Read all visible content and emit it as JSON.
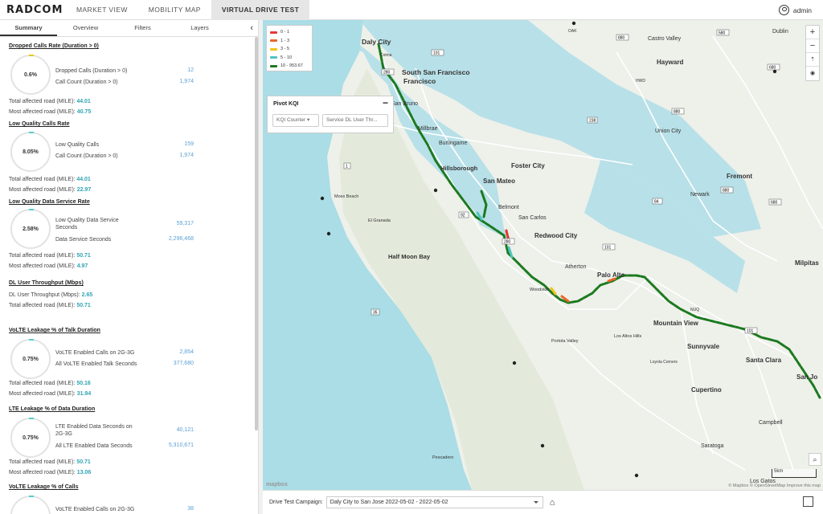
{
  "app": {
    "logo": "RADCOM",
    "user": "admin"
  },
  "nav": [
    {
      "label": "MARKET VIEW"
    },
    {
      "label": "MOBILITY MAP"
    },
    {
      "label": "VIRTUAL DRIVE TEST"
    }
  ],
  "panel_tabs": [
    {
      "label": "Summary"
    },
    {
      "label": "Overview"
    },
    {
      "label": "Filters"
    },
    {
      "label": "Layers"
    }
  ],
  "panel_collapse_glyph": "‹",
  "sections": [
    {
      "title": "Dropped Calls Rate (Duration > 0)",
      "ring": "0.6%",
      "kpis": [
        {
          "label": "Dropped Calls (Duration > 0)",
          "value": "12"
        },
        {
          "label": "Call Count (Duration > 0)",
          "value": "1,974"
        }
      ],
      "miles": [
        {
          "label": "Total affected road (MILE):",
          "value": "44.01"
        },
        {
          "label": "Most affected road (MILE):",
          "value": "40.75"
        }
      ]
    },
    {
      "title": "Low Quality Calls Rate",
      "ring": "8.05%",
      "kpis": [
        {
          "label": "Low Quality Calls",
          "value": "159"
        },
        {
          "label": "Call Count (Duration > 0)",
          "value": "1,974"
        }
      ],
      "miles": [
        {
          "label": "Total affected road (MILE):",
          "value": "44.01"
        },
        {
          "label": "Most affected road (MILE):",
          "value": "22.97"
        }
      ]
    },
    {
      "title": "Low Quality Data Service Rate",
      "ring": "2.58%",
      "kpis": [
        {
          "label": "Low Quality Data Service Seconds",
          "value": "59,317"
        },
        {
          "label": "Data Service Seconds",
          "value": "2,296,468"
        }
      ],
      "miles": [
        {
          "label": "Total affected road (MILE):",
          "value": "50.71"
        },
        {
          "label": "Most affected road (MILE):",
          "value": "4.97"
        }
      ]
    },
    {
      "title": "DL User Throughput (Mbps)",
      "miles": [
        {
          "label": "DL User Throughput (Mbps):",
          "value": "2.65"
        },
        {
          "label": "Total affected road (MILE):",
          "value": "50.71"
        }
      ]
    },
    {
      "title": "VoLTE Leakage % of Talk Duration",
      "ring": "0.75%",
      "kpis": [
        {
          "label": "VoLTE Enabled Calls on 2G-3G",
          "value": "2,854"
        },
        {
          "label": "All VoLTE Enabled Talk Seconds",
          "value": "377,680"
        }
      ],
      "miles": [
        {
          "label": "Total affected road (MILE):",
          "value": "50.16"
        },
        {
          "label": "Most affected road (MILE):",
          "value": "31.94"
        }
      ]
    },
    {
      "title": "LTE Leakage % of Data Duration",
      "ring": "0.75%",
      "kpis": [
        {
          "label": "LTE Enabled Data Seconds on 2G-3G",
          "value": "40,121"
        },
        {
          "label": "All LTE Enabled Data Seconds",
          "value": "5,310,671"
        }
      ],
      "miles": [
        {
          "label": "Total affected road (MILE):",
          "value": "50.71"
        },
        {
          "label": "Most affected road (MILE):",
          "value": "13.06"
        }
      ]
    },
    {
      "title": "VoLTE Leakage % of Calls",
      "kpis": [
        {
          "label": "VoLTE Enabled Calls on 2G-3G",
          "value": "38"
        }
      ]
    }
  ],
  "legend": [
    {
      "label": "0 - 1",
      "color": "#e53935"
    },
    {
      "label": "1 - 3",
      "color": "#e8672a"
    },
    {
      "label": "3 - 5",
      "color": "#f0c419"
    },
    {
      "label": "5 - 10",
      "color": "#4dc3c3"
    },
    {
      "label": "10 - 953.67",
      "color": "#1b7a1f"
    }
  ],
  "pivot": {
    "title": "Pivot KQI",
    "collapse": "−",
    "select1": "KQI Counter",
    "select2": "Service DL User Thr..."
  },
  "map_controls": {
    "zoom_in": "+",
    "zoom_out": "−",
    "scale": "5km",
    "attribution": "© Mapbox © OpenStreetMap  Improve this map",
    "brand": "mapbox"
  },
  "bottom": {
    "campaign_label": "Drive Test Campaign:",
    "campaign_value": "Daly City to San Jose 2022-05-02 - 2022-05-02"
  },
  "map_labels": [
    {
      "t": "Daly City",
      "big": true
    },
    {
      "t": "South San Francisco",
      "big": true
    },
    {
      "t": "San Bruno",
      "big": false
    },
    {
      "t": "Millbrae",
      "big": false
    },
    {
      "t": "Burlingame",
      "big": false
    },
    {
      "t": "Hillsborough",
      "big": true
    },
    {
      "t": "Foster City",
      "big": true
    },
    {
      "t": "San Mateo",
      "big": true
    },
    {
      "t": "Belmont",
      "big": false
    },
    {
      "t": "San Carlos",
      "big": false
    },
    {
      "t": "Redwood City",
      "big": true
    },
    {
      "t": "Atherton",
      "big": false
    },
    {
      "t": "Palo Alto",
      "big": true
    },
    {
      "t": "Woodside",
      "big": false
    },
    {
      "t": "Mountain View",
      "big": true
    },
    {
      "t": "Sunnyvale",
      "big": true
    },
    {
      "t": "Santa Clara",
      "big": true
    },
    {
      "t": "San Jo",
      "big": true
    },
    {
      "t": "Cupertino",
      "big": true
    },
    {
      "t": "Campbell",
      "big": false
    },
    {
      "t": "Saratoga",
      "big": false
    },
    {
      "t": "Los Gatos",
      "big": false
    },
    {
      "t": "Castro Valley",
      "big": false
    },
    {
      "t": "Hayward",
      "big": true
    },
    {
      "t": "Union City",
      "big": false
    },
    {
      "t": "Fremont",
      "big": true
    },
    {
      "t": "Newark",
      "big": false
    },
    {
      "t": "Milpitas",
      "big": true
    },
    {
      "t": "Dublin",
      "big": false
    },
    {
      "t": "Half Moon Bay",
      "big": true
    },
    {
      "t": "Moss Beach",
      "big": false
    },
    {
      "t": "El Granada",
      "big": false
    },
    {
      "t": "Portola Valley",
      "big": false
    },
    {
      "t": "Los Altos Hills",
      "big": false
    },
    {
      "t": "Pescadero",
      "big": false
    },
    {
      "t": "Loyola Corners",
      "big": false
    },
    {
      "t": "Colma",
      "big": false
    },
    {
      "t": "HWD",
      "big": false
    },
    {
      "t": "NUQ",
      "big": false
    },
    {
      "t": "OAK",
      "big": false
    }
  ],
  "road_badges": [
    "580",
    "880",
    "238",
    "680",
    "101",
    "92",
    "84",
    "280",
    "1",
    "35",
    "101",
    "880",
    "680",
    "280",
    "101",
    "880"
  ]
}
